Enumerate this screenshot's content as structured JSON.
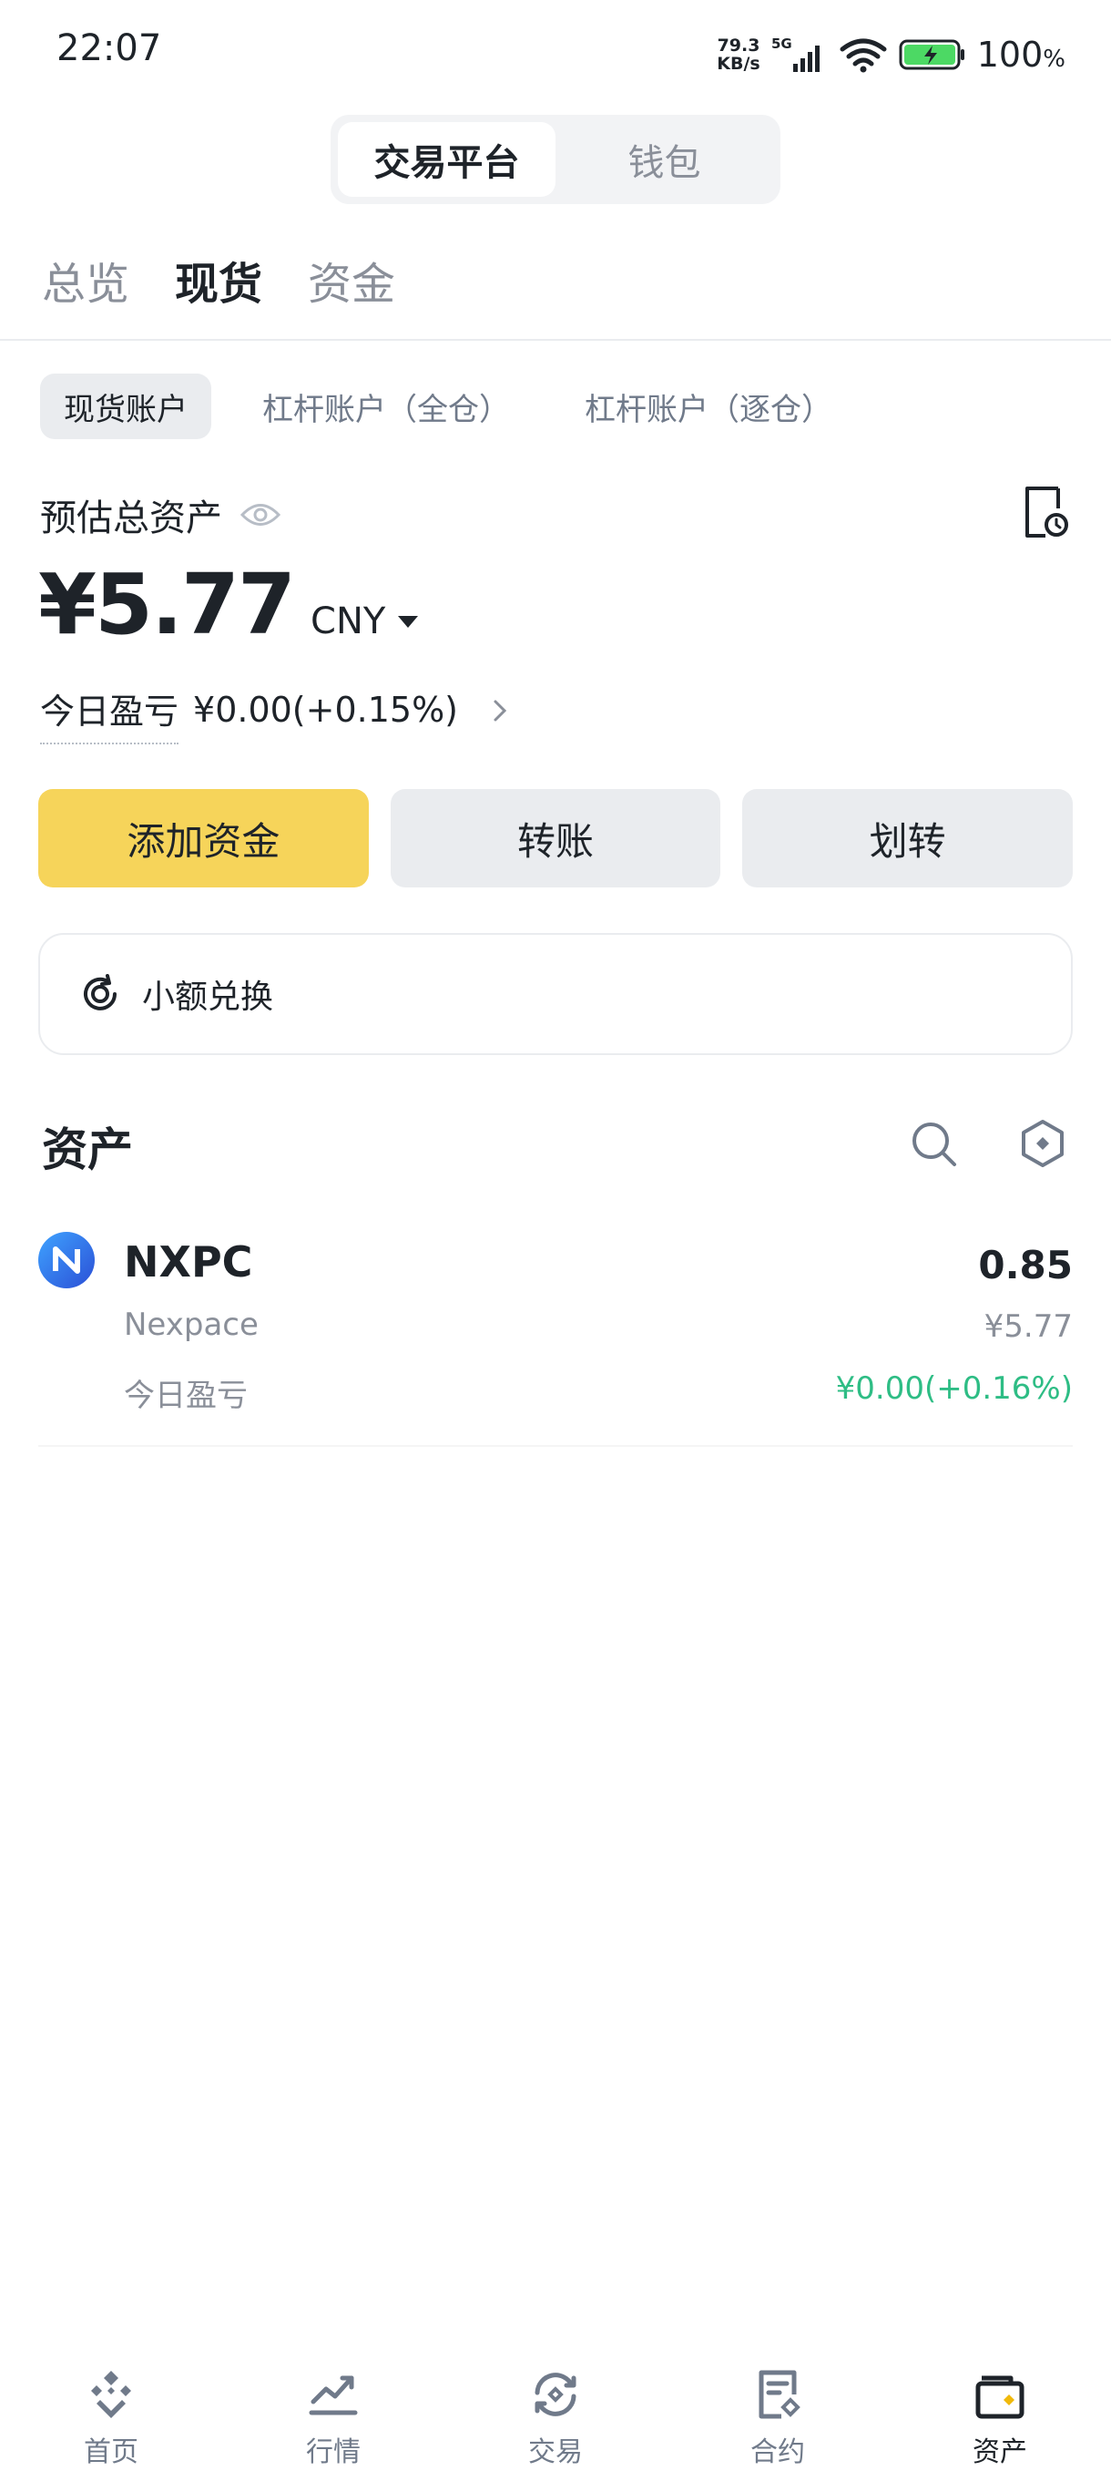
{
  "status_bar": {
    "time": "22:07",
    "net_speed_value": "79.3",
    "net_speed_unit": "KB/s",
    "network": "5G",
    "battery_value": "100",
    "battery_unit": "%"
  },
  "platform": {
    "tabs": [
      {
        "label": "交易平台",
        "active": true
      },
      {
        "label": "钱包",
        "active": false
      }
    ]
  },
  "top_tabs": [
    {
      "label": "总览",
      "active": false
    },
    {
      "label": "现货",
      "active": true
    },
    {
      "label": "资金",
      "active": false
    }
  ],
  "account_tabs": [
    {
      "label": "现货账户",
      "active": true
    },
    {
      "label": "杠杆账户（全仓）",
      "active": false
    },
    {
      "label": "杠杆账户（逐仓）",
      "active": false
    }
  ],
  "summary": {
    "est_label": "预估总资产",
    "total_value": "¥5.77",
    "currency": "CNY",
    "pnl_label": "今日盈亏",
    "pnl_value": "¥0.00(+0.15%)"
  },
  "actions": {
    "add_funds": "添加资金",
    "transfer": "转账",
    "internal_transfer": "划转"
  },
  "convert": {
    "label": "小额兑换"
  },
  "assets": {
    "title": "资产",
    "items": [
      {
        "symbol": "NXPC",
        "name": "Nexpace",
        "amount": "0.85",
        "value": "¥5.77",
        "pnl_label": "今日盈亏",
        "pnl": "¥0.00(+0.16%)"
      }
    ]
  },
  "bottom_nav": [
    {
      "label": "首页",
      "icon": "home-icon",
      "active": false
    },
    {
      "label": "行情",
      "icon": "markets-icon",
      "active": false
    },
    {
      "label": "交易",
      "icon": "trade-icon",
      "active": false
    },
    {
      "label": "合约",
      "icon": "futures-icon",
      "active": false
    },
    {
      "label": "资产",
      "icon": "wallet-icon",
      "active": true
    }
  ],
  "colors": {
    "accent": "#f6d45a",
    "positive": "#2ebd85",
    "text_primary": "#1e2329",
    "text_secondary": "#8a8f99"
  }
}
